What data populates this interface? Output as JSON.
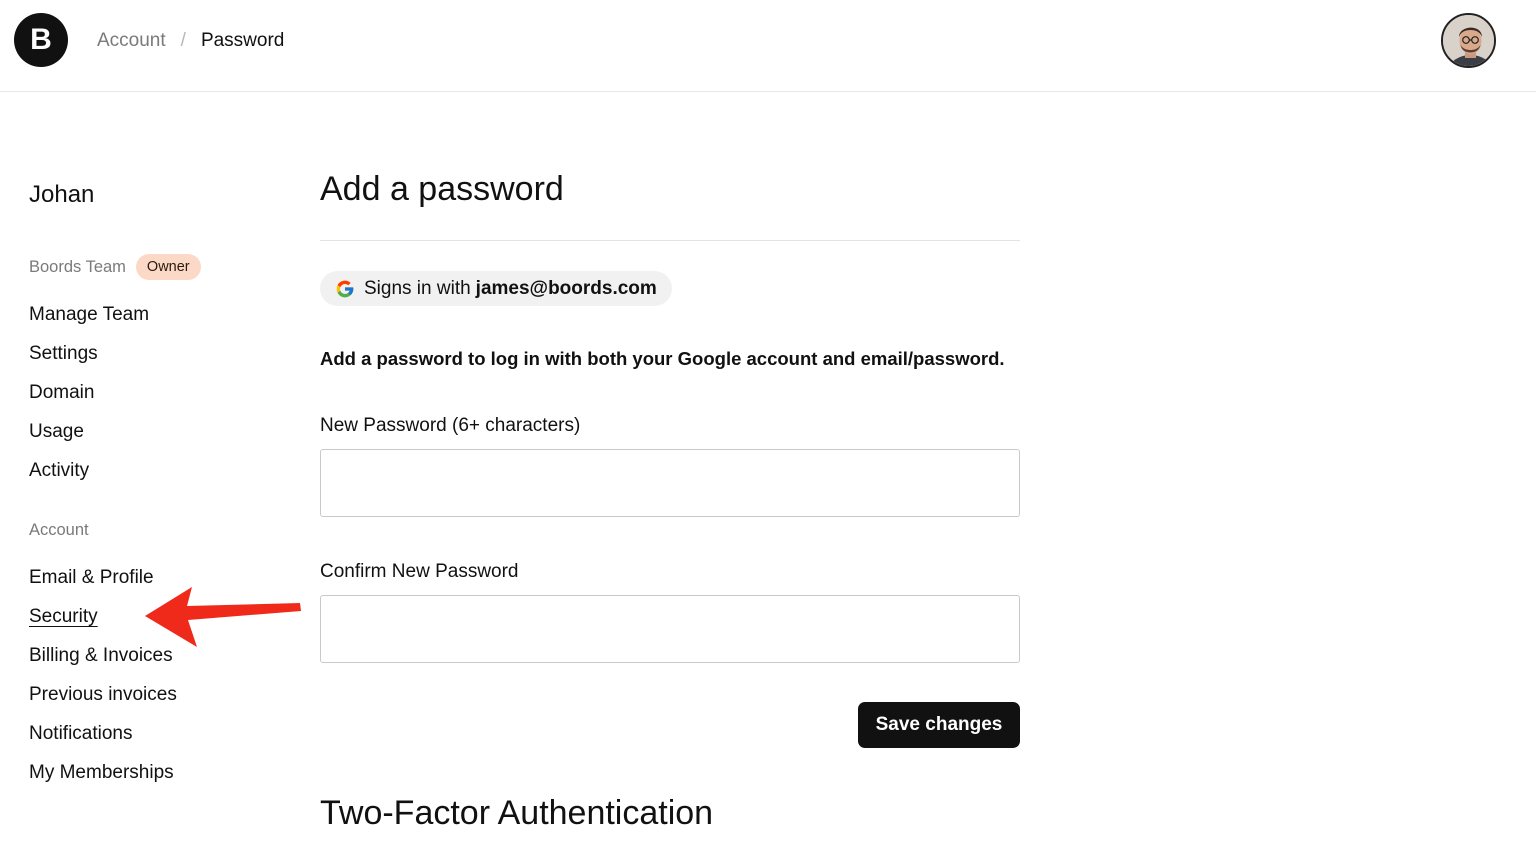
{
  "header": {
    "logo_letter": "B",
    "breadcrumb": {
      "parent": "Account",
      "separator": "/",
      "current": "Password"
    }
  },
  "sidebar": {
    "user_name": "Johan",
    "team": {
      "name": "Boords Team",
      "badge": "Owner"
    },
    "team_items": [
      {
        "label": "Manage Team"
      },
      {
        "label": "Settings"
      },
      {
        "label": "Domain"
      },
      {
        "label": "Usage"
      },
      {
        "label": "Activity"
      }
    ],
    "account_label": "Account",
    "account_items": [
      {
        "label": "Email & Profile"
      },
      {
        "label": "Security",
        "active": true
      },
      {
        "label": "Billing & Invoices"
      },
      {
        "label": "Previous invoices"
      },
      {
        "label": "Notifications"
      },
      {
        "label": "My Memberships"
      }
    ]
  },
  "main": {
    "title": "Add a password",
    "google_pill": {
      "prefix": "Signs in with",
      "email": "james@boords.com"
    },
    "info": "Add a password to log in with both your Google account and email/password.",
    "new_password": {
      "label": "New Password (6+ characters)",
      "value": ""
    },
    "confirm_password": {
      "label": "Confirm New Password",
      "value": ""
    },
    "save_label": "Save changes",
    "section2_title": "Two-Factor Authentication"
  },
  "colors": {
    "arrow": "#f02a1a",
    "badge_bg": "#fbd9c6",
    "button_bg": "#111111"
  },
  "icons": [
    "google-icon",
    "user-avatar",
    "annotation-arrow"
  ]
}
